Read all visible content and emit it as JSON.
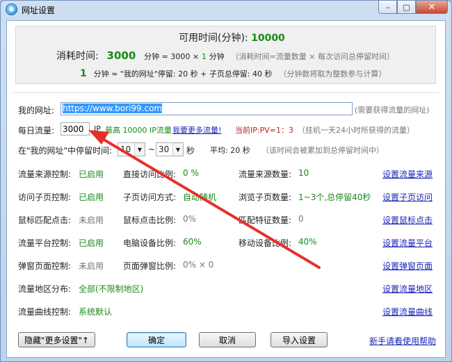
{
  "window": {
    "title": "网址设置",
    "minimize": "–",
    "maximize": "□",
    "close": "✕"
  },
  "summary": {
    "available_label": "可用时间(分钟):",
    "available_value": "10000",
    "consume_label": "消耗时间:",
    "consume_value": "3000",
    "consume_formula": "分钟 = 3000 ×",
    "consume_multiplier": "1",
    "consume_unit": "分钟",
    "consume_note": "（消耗时间=流量数量 × 每次访问总停留时间）",
    "minute_count": "1",
    "minute_formula": "分钟 ≈ \"我的网址\"停留: 20 秒 + 子页总停留: 40 秒",
    "minute_note": "（分钟数将取为整数参与计算）"
  },
  "url_row": {
    "label": "我的网址:",
    "value": "https://www.bori99.com",
    "hint": "(需要获得流量的网址)"
  },
  "traffic_row": {
    "label": "每日流量:",
    "value": "3000",
    "unit": "IP",
    "max_text": "最高 10000 IP流量",
    "more_link": "我要更多流量!",
    "ratio": "当前IP:PV=1：3",
    "note": "（挂机一天24小时所获得的流量）"
  },
  "stay_row": {
    "label": "在\"我的网址\"中停留时间:",
    "min_value": "10",
    "tilde": "~",
    "max_value": "30",
    "sec_unit": "秒",
    "avg_text": "平均: 20 秒",
    "note": "（该时间会被累加到总停留时间中）"
  },
  "settings": [
    {
      "label": "流量来源控制:",
      "status": "已启用",
      "enabled": true,
      "mid_label": "直接访问比例:",
      "mid_value": "0 %",
      "mid_enabled": true,
      "right_label": "流量来源数量:",
      "right_value": "10",
      "right_enabled": true,
      "link": "设置流量来源"
    },
    {
      "label": "访问子页控制:",
      "status": "已启用",
      "enabled": true,
      "mid_label": "子页访问方式:",
      "mid_value": "自动随机",
      "mid_enabled": true,
      "right_label": "浏览子页数量:",
      "right_value": "1~3个,总停留40秒",
      "right_enabled": true,
      "link": "设置子页访问"
    },
    {
      "label": "鼠标匹配点击:",
      "status": "未启用",
      "enabled": false,
      "mid_label": "鼠标点击比例:",
      "mid_value": "0%",
      "mid_enabled": false,
      "right_label": "匹配特征数量:",
      "right_value": "0",
      "right_enabled": false,
      "link": "设置鼠标点击"
    },
    {
      "label": "流量平台控制:",
      "status": "已启用",
      "enabled": true,
      "mid_label": "电脑设备比例:",
      "mid_value": "60%",
      "mid_enabled": true,
      "right_label": "移动设备比例:",
      "right_value": "40%",
      "right_enabled": true,
      "link": "设置流量平台"
    },
    {
      "label": "弹窗页面控制:",
      "status": "未启用",
      "enabled": false,
      "mid_label": "页面弹窗比例:",
      "mid_value": "0% × 0",
      "mid_enabled": false,
      "right_label": "",
      "right_value": "",
      "right_enabled": false,
      "link": "设置弹窗页面"
    },
    {
      "label": "流量地区分布:",
      "status": "全部(不限制地区)",
      "enabled": true,
      "mid_label": "",
      "mid_value": "",
      "mid_enabled": false,
      "right_label": "",
      "right_value": "",
      "right_enabled": false,
      "link": "设置流量地区"
    },
    {
      "label": "流量曲线控制:",
      "status": "系统默认",
      "enabled": true,
      "mid_label": "",
      "mid_value": "",
      "mid_enabled": false,
      "right_label": "",
      "right_value": "",
      "right_enabled": false,
      "link": "设置流量曲线"
    }
  ],
  "buttons": {
    "hide_more": "隐藏\"更多设置\"↑",
    "ok": "确定",
    "cancel": "取消",
    "import": "导入设置",
    "help_link": "新手请看使用帮助"
  },
  "colors": {
    "enabled_green": "#1a8a1a",
    "disabled_grey": "#777777",
    "annotation_arrow": "#e8302a",
    "link_blue": "#1b24b8"
  }
}
